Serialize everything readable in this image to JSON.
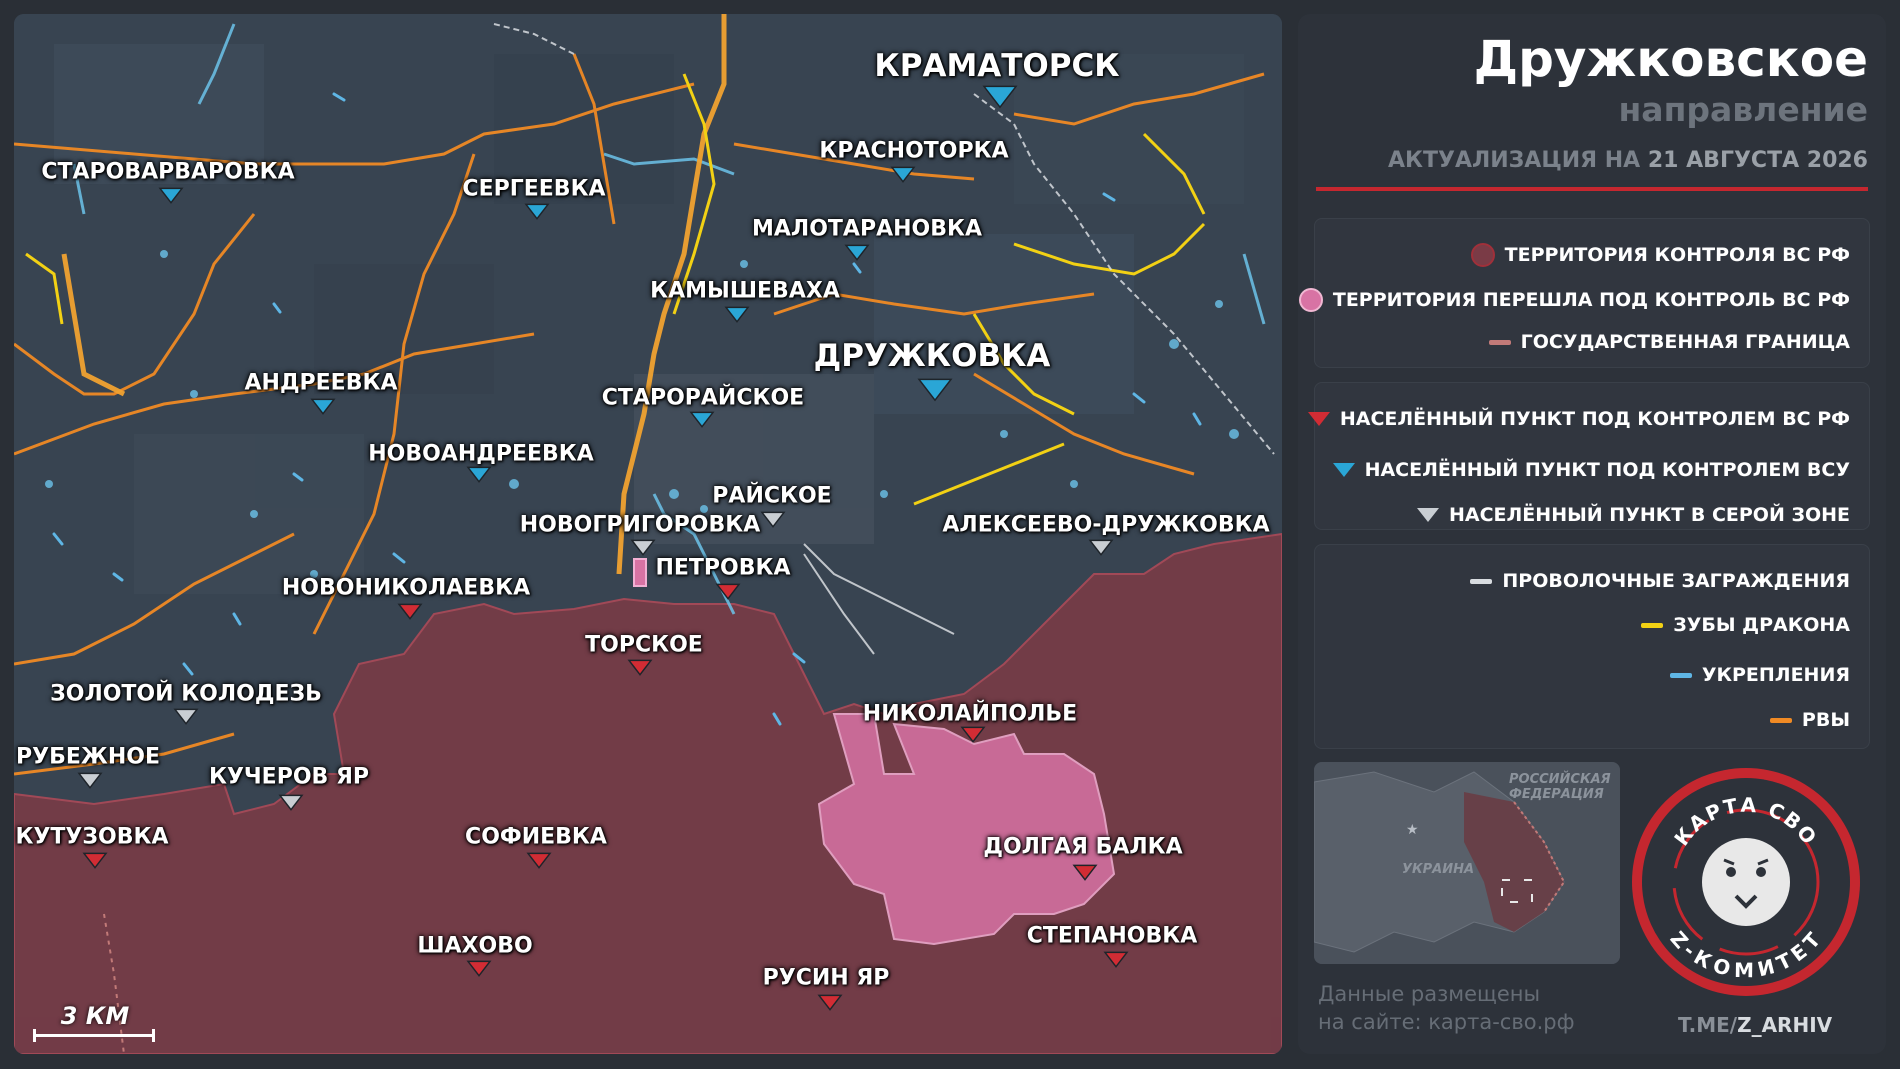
{
  "colors": {
    "rf_control": "#7a3b46",
    "transferred": "#d873a4",
    "border": "#c27a78",
    "rf_marker": "#d22c34",
    "afu_marker": "#2aa6d6",
    "gray_marker": "#c9ced3",
    "wire": "#d8dce0",
    "dragon_teeth": "#f2d114",
    "fortifications": "#5fb6e5",
    "ditches": "#f08a24"
  },
  "map": {
    "towns": [
      {
        "id": "kramatorsk",
        "name": "КРАМАТОРСК",
        "status": "afu",
        "big": true
      },
      {
        "id": "krasnotorka",
        "name": "КРАСНОТОРКА",
        "status": "afu"
      },
      {
        "id": "starovarvarovka",
        "name": "СТАРОВАРВАРОВКА",
        "status": "afu"
      },
      {
        "id": "sergeevka",
        "name": "СЕРГЕЕВКА",
        "status": "afu"
      },
      {
        "id": "malotaranovka",
        "name": "МАЛОТАРАНОВКА",
        "status": "afu"
      },
      {
        "id": "kamyshevakha",
        "name": "КАМЫШЕВАХА",
        "status": "afu"
      },
      {
        "id": "druzhkovka",
        "name": "ДРУЖКОВКА",
        "status": "afu",
        "big": true
      },
      {
        "id": "andreevka",
        "name": "АНДРЕЕВКА",
        "status": "afu"
      },
      {
        "id": "starorayskoe",
        "name": "СТАРОРАЙСКОЕ",
        "status": "afu"
      },
      {
        "id": "novoandreevka",
        "name": "НОВОАНДРЕЕВКА",
        "status": "afu"
      },
      {
        "id": "rayskoe",
        "name": "РАЙСКОЕ",
        "status": "gray"
      },
      {
        "id": "novogrigorovka",
        "name": "НОВОГРИГОРОВКА",
        "status": "gray"
      },
      {
        "id": "alekseevo",
        "name": "АЛЕКСЕЕВО-ДРУЖКОВКА",
        "status": "gray"
      },
      {
        "id": "petrovka",
        "name": "ПЕТРОВКА",
        "status": "rf"
      },
      {
        "id": "novonikolaevka",
        "name": "НОВОНИКОЛАЕВКА",
        "status": "rf"
      },
      {
        "id": "torskoe",
        "name": "ТОРСКОЕ",
        "status": "rf"
      },
      {
        "id": "zolotoy",
        "name": "ЗОЛОТОЙ КОЛОДЕЗЬ",
        "status": "gray"
      },
      {
        "id": "nikolaypole",
        "name": "НИКОЛАЙПОЛЬЕ",
        "status": "rf"
      },
      {
        "id": "rubezhnoe",
        "name": "РУБЕЖНОЕ",
        "status": "gray"
      },
      {
        "id": "kucherov",
        "name": "КУЧЕРОВ ЯР",
        "status": "gray"
      },
      {
        "id": "kutuzovka",
        "name": "КУТУЗОВКА",
        "status": "rf"
      },
      {
        "id": "sofievka",
        "name": "СОФИЕВКА",
        "status": "rf"
      },
      {
        "id": "dolgaya",
        "name": "ДОЛГАЯ БАЛКА",
        "status": "rf"
      },
      {
        "id": "stepanovka",
        "name": "СТЕПАНОВКА",
        "status": "rf"
      },
      {
        "id": "shakhovo",
        "name": "ШАХОВО",
        "status": "rf"
      },
      {
        "id": "rusin",
        "name": "РУСИН ЯР",
        "status": "rf"
      }
    ],
    "scale_label": "3 КМ"
  },
  "panel": {
    "title": "Дружковское",
    "subtitle": "направление",
    "update_prefix": "АКТУАЛИЗАЦИЯ НА",
    "update_date": "21 АВГУСТА 2026",
    "legend_areas": [
      {
        "label": "ТЕРРИТОРИЯ КОНТРОЛЯ ВС РФ"
      },
      {
        "label": "ТЕРРИТОРИЯ ПЕРЕШЛА ПОД КОНТРОЛЬ ВС РФ"
      },
      {
        "label": "ГОСУДАРСТВЕННАЯ ГРАНИЦА"
      }
    ],
    "legend_points": [
      {
        "label": "НАСЕЛЁННЫЙ ПУНКТ ПОД КОНТРОЛЕМ ВС РФ"
      },
      {
        "label": "НАСЕЛЁННЫЙ ПУНКТ ПОД КОНТРОЛЕМ ВСУ"
      },
      {
        "label": "НАСЕЛЁННЫЙ ПУНКТ В СЕРОЙ ЗОНЕ"
      }
    ],
    "legend_lines": [
      {
        "label": "ПРОВОЛОЧНЫЕ ЗАГРАЖДЕНИЯ"
      },
      {
        "label": "ЗУБЫ ДРАКОНА"
      },
      {
        "label": "УКРЕПЛЕНИЯ"
      },
      {
        "label": "РВЫ"
      }
    ],
    "minimap": {
      "russia_label": "РОССИЙСКАЯ ФЕДЕРАЦИЯ",
      "ukraine_label": "УКРАИНА"
    },
    "logo": {
      "top_text": "КАРТА СВО",
      "bottom_text": "Z-КОМИТЕТ"
    },
    "site_note_line1": "Данные размещены",
    "site_note_line2": "на сайте: карта-сво.рф",
    "handle_prefix": "T.ME/",
    "handle_name": "Z_ARHIV"
  }
}
